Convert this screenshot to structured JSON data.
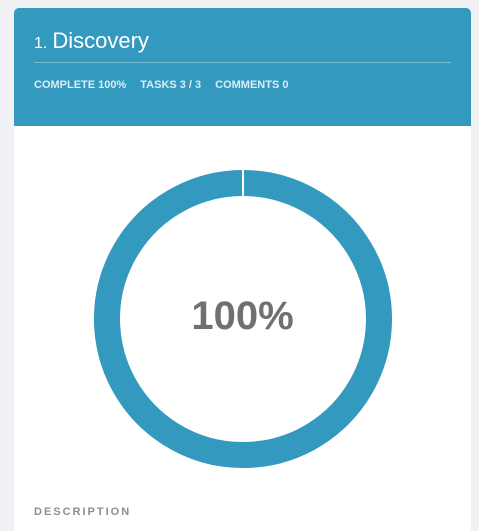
{
  "card": {
    "step_number": "1.",
    "title": "Discovery",
    "meta": {
      "complete_label": "COMPLETE",
      "complete_value": "100%",
      "tasks_label": "TASKS",
      "tasks_value": "3 / 3",
      "comments_label": "COMMENTS",
      "comments_value": "0"
    },
    "progress": {
      "percent_text": "100%",
      "fraction": 1.0
    },
    "description_label": "DESCRIPTION"
  },
  "colors": {
    "accent": "#3499be",
    "page_background": "#f0f0f5",
    "progress_text": "#707070"
  }
}
